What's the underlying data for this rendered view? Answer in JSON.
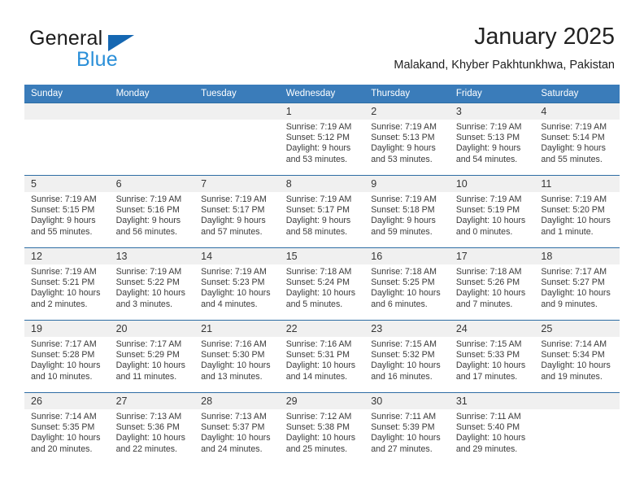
{
  "brand": {
    "name_part1": "General",
    "name_part2": "Blue",
    "flag_icon": "triangle-flag-icon"
  },
  "header": {
    "title": "January 2025",
    "subtitle": "Malakand, Khyber Pakhtunkhwa, Pakistan"
  },
  "colors": {
    "header_blue": "#3a7cba",
    "row_border_blue": "#2e6da4",
    "daynum_band": "#f0f0f0",
    "brand_blue": "#2a8fd8",
    "flag_blue": "#1567b2"
  },
  "weekday_headers": [
    "Sunday",
    "Monday",
    "Tuesday",
    "Wednesday",
    "Thursday",
    "Friday",
    "Saturday"
  ],
  "weeks": [
    [
      {
        "day": "",
        "lines": []
      },
      {
        "day": "",
        "lines": []
      },
      {
        "day": "",
        "lines": []
      },
      {
        "day": "1",
        "lines": [
          "Sunrise: 7:19 AM",
          "Sunset: 5:12 PM",
          "Daylight: 9 hours",
          "and 53 minutes."
        ]
      },
      {
        "day": "2",
        "lines": [
          "Sunrise: 7:19 AM",
          "Sunset: 5:13 PM",
          "Daylight: 9 hours",
          "and 53 minutes."
        ]
      },
      {
        "day": "3",
        "lines": [
          "Sunrise: 7:19 AM",
          "Sunset: 5:13 PM",
          "Daylight: 9 hours",
          "and 54 minutes."
        ]
      },
      {
        "day": "4",
        "lines": [
          "Sunrise: 7:19 AM",
          "Sunset: 5:14 PM",
          "Daylight: 9 hours",
          "and 55 minutes."
        ]
      }
    ],
    [
      {
        "day": "5",
        "lines": [
          "Sunrise: 7:19 AM",
          "Sunset: 5:15 PM",
          "Daylight: 9 hours",
          "and 55 minutes."
        ]
      },
      {
        "day": "6",
        "lines": [
          "Sunrise: 7:19 AM",
          "Sunset: 5:16 PM",
          "Daylight: 9 hours",
          "and 56 minutes."
        ]
      },
      {
        "day": "7",
        "lines": [
          "Sunrise: 7:19 AM",
          "Sunset: 5:17 PM",
          "Daylight: 9 hours",
          "and 57 minutes."
        ]
      },
      {
        "day": "8",
        "lines": [
          "Sunrise: 7:19 AM",
          "Sunset: 5:17 PM",
          "Daylight: 9 hours",
          "and 58 minutes."
        ]
      },
      {
        "day": "9",
        "lines": [
          "Sunrise: 7:19 AM",
          "Sunset: 5:18 PM",
          "Daylight: 9 hours",
          "and 59 minutes."
        ]
      },
      {
        "day": "10",
        "lines": [
          "Sunrise: 7:19 AM",
          "Sunset: 5:19 PM",
          "Daylight: 10 hours",
          "and 0 minutes."
        ]
      },
      {
        "day": "11",
        "lines": [
          "Sunrise: 7:19 AM",
          "Sunset: 5:20 PM",
          "Daylight: 10 hours",
          "and 1 minute."
        ]
      }
    ],
    [
      {
        "day": "12",
        "lines": [
          "Sunrise: 7:19 AM",
          "Sunset: 5:21 PM",
          "Daylight: 10 hours",
          "and 2 minutes."
        ]
      },
      {
        "day": "13",
        "lines": [
          "Sunrise: 7:19 AM",
          "Sunset: 5:22 PM",
          "Daylight: 10 hours",
          "and 3 minutes."
        ]
      },
      {
        "day": "14",
        "lines": [
          "Sunrise: 7:19 AM",
          "Sunset: 5:23 PM",
          "Daylight: 10 hours",
          "and 4 minutes."
        ]
      },
      {
        "day": "15",
        "lines": [
          "Sunrise: 7:18 AM",
          "Sunset: 5:24 PM",
          "Daylight: 10 hours",
          "and 5 minutes."
        ]
      },
      {
        "day": "16",
        "lines": [
          "Sunrise: 7:18 AM",
          "Sunset: 5:25 PM",
          "Daylight: 10 hours",
          "and 6 minutes."
        ]
      },
      {
        "day": "17",
        "lines": [
          "Sunrise: 7:18 AM",
          "Sunset: 5:26 PM",
          "Daylight: 10 hours",
          "and 7 minutes."
        ]
      },
      {
        "day": "18",
        "lines": [
          "Sunrise: 7:17 AM",
          "Sunset: 5:27 PM",
          "Daylight: 10 hours",
          "and 9 minutes."
        ]
      }
    ],
    [
      {
        "day": "19",
        "lines": [
          "Sunrise: 7:17 AM",
          "Sunset: 5:28 PM",
          "Daylight: 10 hours",
          "and 10 minutes."
        ]
      },
      {
        "day": "20",
        "lines": [
          "Sunrise: 7:17 AM",
          "Sunset: 5:29 PM",
          "Daylight: 10 hours",
          "and 11 minutes."
        ]
      },
      {
        "day": "21",
        "lines": [
          "Sunrise: 7:16 AM",
          "Sunset: 5:30 PM",
          "Daylight: 10 hours",
          "and 13 minutes."
        ]
      },
      {
        "day": "22",
        "lines": [
          "Sunrise: 7:16 AM",
          "Sunset: 5:31 PM",
          "Daylight: 10 hours",
          "and 14 minutes."
        ]
      },
      {
        "day": "23",
        "lines": [
          "Sunrise: 7:15 AM",
          "Sunset: 5:32 PM",
          "Daylight: 10 hours",
          "and 16 minutes."
        ]
      },
      {
        "day": "24",
        "lines": [
          "Sunrise: 7:15 AM",
          "Sunset: 5:33 PM",
          "Daylight: 10 hours",
          "and 17 minutes."
        ]
      },
      {
        "day": "25",
        "lines": [
          "Sunrise: 7:14 AM",
          "Sunset: 5:34 PM",
          "Daylight: 10 hours",
          "and 19 minutes."
        ]
      }
    ],
    [
      {
        "day": "26",
        "lines": [
          "Sunrise: 7:14 AM",
          "Sunset: 5:35 PM",
          "Daylight: 10 hours",
          "and 20 minutes."
        ]
      },
      {
        "day": "27",
        "lines": [
          "Sunrise: 7:13 AM",
          "Sunset: 5:36 PM",
          "Daylight: 10 hours",
          "and 22 minutes."
        ]
      },
      {
        "day": "28",
        "lines": [
          "Sunrise: 7:13 AM",
          "Sunset: 5:37 PM",
          "Daylight: 10 hours",
          "and 24 minutes."
        ]
      },
      {
        "day": "29",
        "lines": [
          "Sunrise: 7:12 AM",
          "Sunset: 5:38 PM",
          "Daylight: 10 hours",
          "and 25 minutes."
        ]
      },
      {
        "day": "30",
        "lines": [
          "Sunrise: 7:11 AM",
          "Sunset: 5:39 PM",
          "Daylight: 10 hours",
          "and 27 minutes."
        ]
      },
      {
        "day": "31",
        "lines": [
          "Sunrise: 7:11 AM",
          "Sunset: 5:40 PM",
          "Daylight: 10 hours",
          "and 29 minutes."
        ]
      },
      {
        "day": "",
        "lines": []
      }
    ]
  ]
}
